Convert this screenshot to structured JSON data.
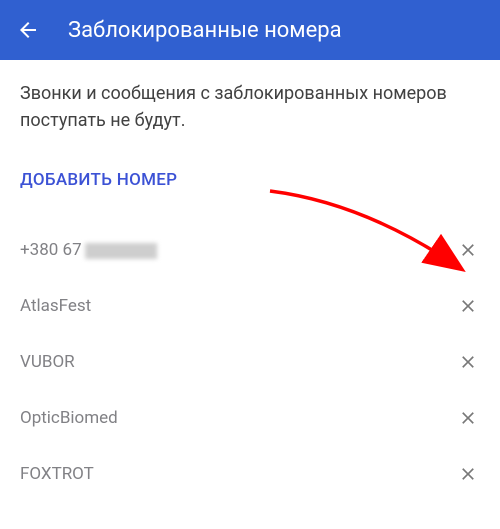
{
  "header": {
    "title": "Заблокированные номера"
  },
  "description": "Звонки и сообщения с заблокированных номеров поступать не будут.",
  "addButton": "ДОБАВИТЬ НОМЕР",
  "items": [
    {
      "label": "+380 67"
    },
    {
      "label": "AtlasFest"
    },
    {
      "label": "VUBOR"
    },
    {
      "label": "OpticBiomed"
    },
    {
      "label": "FOXTROT"
    }
  ]
}
